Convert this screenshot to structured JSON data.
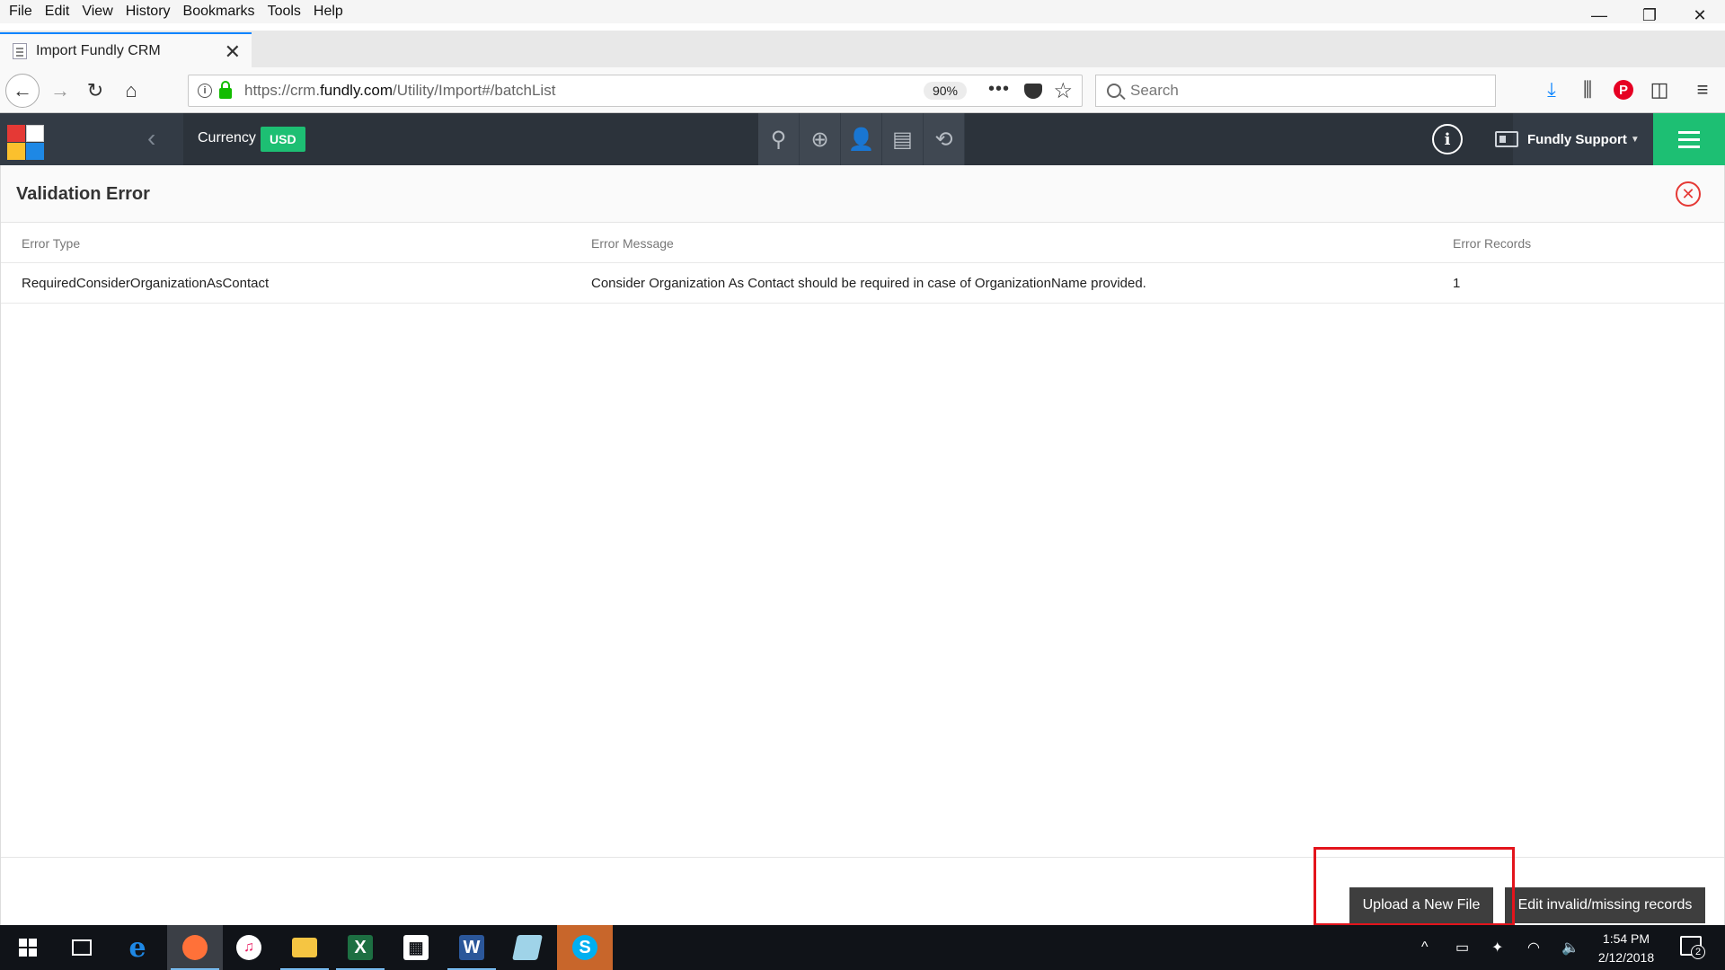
{
  "menubar": {
    "items": [
      "File",
      "Edit",
      "View",
      "History",
      "Bookmarks",
      "Tools",
      "Help"
    ]
  },
  "tab": {
    "title": "Import Fundly CRM"
  },
  "navbar": {
    "url_prefix": "https://crm.",
    "url_domain": "fundly.com",
    "url_path": "/Utility/Import#/batchList",
    "zoom": "90%",
    "search_placeholder": "Search"
  },
  "app": {
    "currency_label": "Currency",
    "currency_value": "USD",
    "icons": [
      "search-icon",
      "add-icon",
      "contact-icon",
      "receipt-icon",
      "history-icon"
    ],
    "user_name": "Fundly Support",
    "colors": {
      "header": "#333b45",
      "accent": "#1dbf73"
    }
  },
  "dialog": {
    "title": "Validation Error",
    "columns": [
      "Error Type",
      "Error Message",
      "Error Records"
    ],
    "rows": [
      {
        "type": "RequiredConsiderOrganizationAsContact",
        "message": "Consider Organization As Contact should be required in case of OrganizationName provided.",
        "records": "1"
      }
    ],
    "upload_label": "Upload a New File",
    "edit_label": "Edit invalid/missing records"
  },
  "taskbar": {
    "time": "1:54 PM",
    "date": "2/12/2018",
    "notification_count": "2",
    "apps": [
      "start",
      "task-view",
      "edge",
      "firefox",
      "itunes",
      "file-explorer",
      "excel",
      "calculator",
      "word",
      "notepad",
      "skype"
    ]
  }
}
